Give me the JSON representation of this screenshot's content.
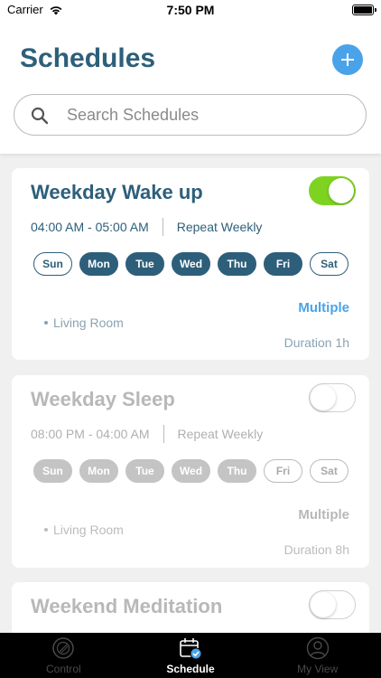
{
  "status_bar": {
    "carrier": "Carrier",
    "time": "7:50 PM"
  },
  "header": {
    "title": "Schedules",
    "add_label": "+"
  },
  "search": {
    "placeholder": "Search Schedules"
  },
  "schedules": [
    {
      "title": "Weekday Wake up",
      "enabled": true,
      "time_range": "04:00 AM - 05:00 AM",
      "repeat": "Repeat Weekly",
      "days": [
        "Sun",
        "Mon",
        "Tue",
        "Wed",
        "Thu",
        "Fri",
        "Sat"
      ],
      "selected_days": [
        "Mon",
        "Tue",
        "Wed",
        "Thu",
        "Fri"
      ],
      "multiple_label": "Multiple",
      "room": "Living Room",
      "duration": "Duration 1h"
    },
    {
      "title": "Weekday Sleep",
      "enabled": false,
      "time_range": "08:00 PM - 04:00 AM",
      "repeat": "Repeat Weekly",
      "days": [
        "Sun",
        "Mon",
        "Tue",
        "Wed",
        "Thu",
        "Fri",
        "Sat"
      ],
      "selected_days": [
        "Sun",
        "Mon",
        "Tue",
        "Wed",
        "Thu"
      ],
      "multiple_label": "Multiple",
      "room": "Living Room",
      "duration": "Duration 8h"
    },
    {
      "title": "Weekend Meditation",
      "enabled": false
    }
  ],
  "tab_bar": {
    "tabs": [
      {
        "label": "Control",
        "icon": "control-icon",
        "active": false
      },
      {
        "label": "Schedule",
        "icon": "calendar-check-icon",
        "active": true
      },
      {
        "label": "My View",
        "icon": "user-icon",
        "active": false
      }
    ]
  },
  "colors": {
    "primary": "#2d5f7a",
    "accent": "#4aa3e8",
    "toggle_on": "#7ed321",
    "disabled": "#b8b8b8"
  }
}
